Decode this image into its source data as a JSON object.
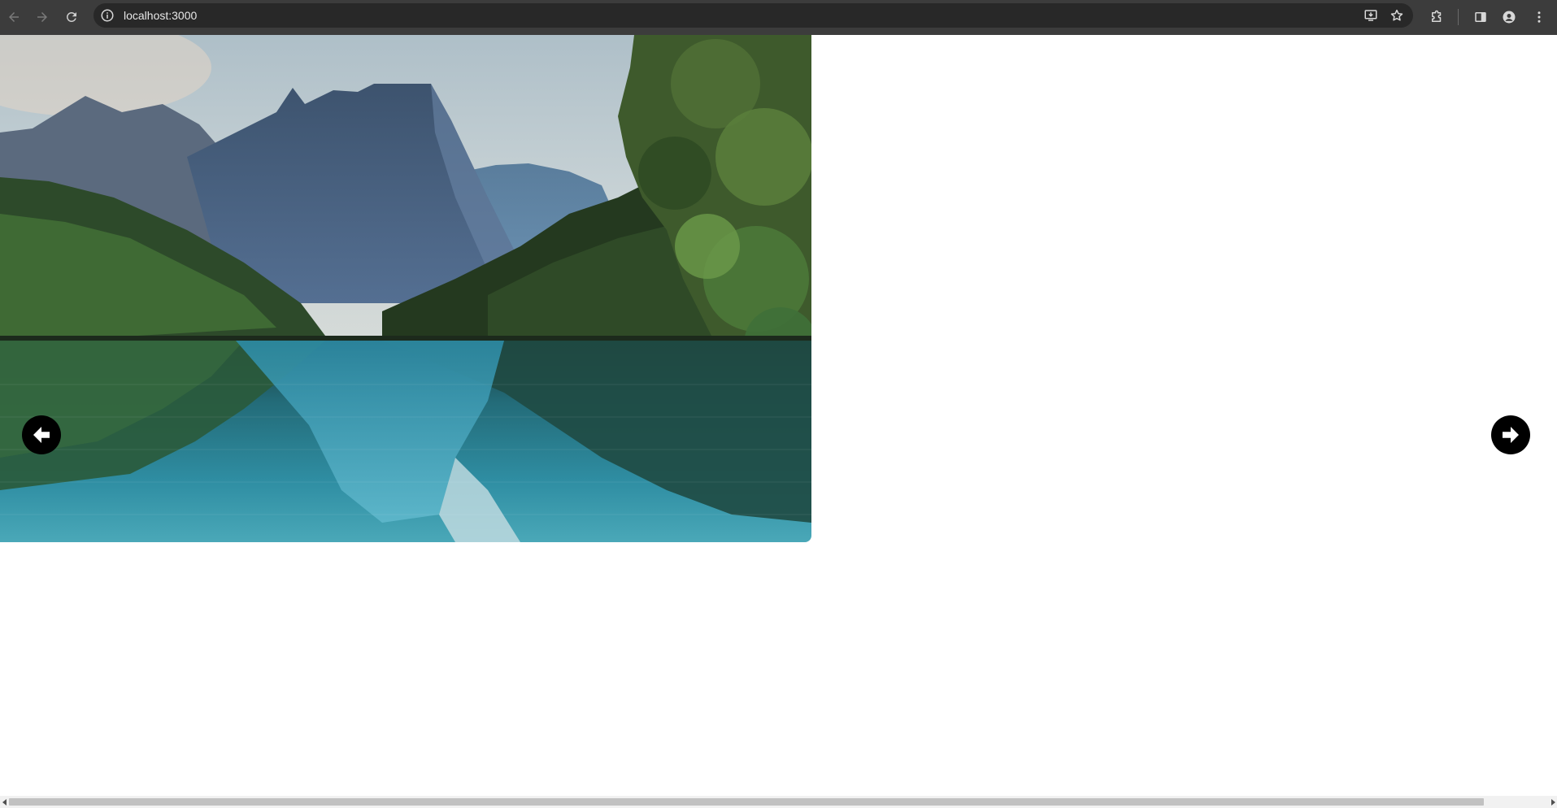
{
  "browser": {
    "url": "localhost:3000",
    "icons": {
      "back": "arrow-left-icon",
      "forward": "arrow-right-icon",
      "reload": "reload-icon",
      "site_info": "info-icon",
      "install": "install-app-icon",
      "bookmark": "star-icon",
      "extensions": "puzzle-icon",
      "side_panel": "side-panel-icon",
      "profile": "profile-icon",
      "menu": "kebab-menu-icon"
    },
    "colors": {
      "toolbar": "#3c3c3c",
      "omnibox": "#282828"
    }
  },
  "carousel": {
    "image": "mountain-lake-landscape",
    "prev_icon": "arrow-circle-left-icon",
    "next_icon": "arrow-circle-right-icon",
    "colors": {
      "arrow_bg": "#000000",
      "arrow_fg": "#ffffff"
    }
  }
}
